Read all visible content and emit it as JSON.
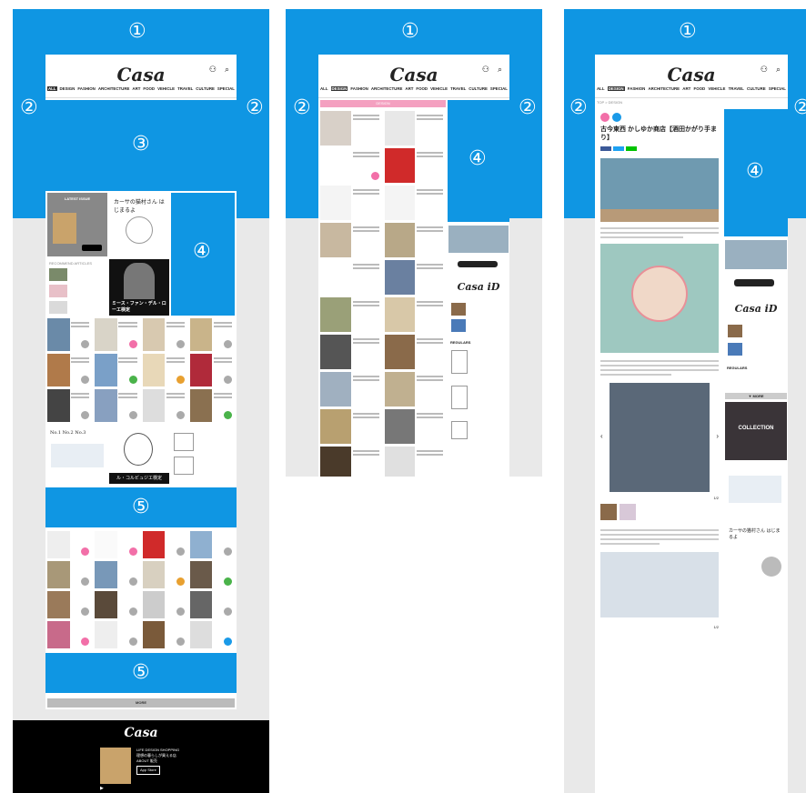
{
  "brand": {
    "logo": "Casa",
    "logo_id": "Casa iD",
    "accent": "#0f96e3"
  },
  "zones": {
    "one": "①",
    "two": "②",
    "three": "③",
    "four": "④",
    "five": "⑤"
  },
  "header": {
    "login_label": "LOGIN",
    "search_label": "SEARCH"
  },
  "nav": {
    "items": [
      "ALL",
      "DESIGN",
      "FASHION",
      "ARCHITECTURE",
      "ART",
      "FOOD",
      "VEHICLE",
      "TRAVEL",
      "CULTURE",
      "SPECIAL"
    ]
  },
  "frame1": {
    "latest_issue": "LATEST ISSUE",
    "recommend": "RECOMMEND ARTICLES",
    "promo_cursive": "カーサの猫村さん はじまるよ",
    "promo_portrait": "ミース・ファン・デル・ローエ検定",
    "promo_corbu": "ル・コルビュジエ検定",
    "more": "MORE",
    "footer_line1": "LIFE DESIGN SHOPPING",
    "footer_line2": "理想の暮らしが買える店",
    "footer_line3": "ABOUT 販売",
    "app_store": "App Store",
    "footer_bottom": "Casa BRUTUS"
  },
  "frame2": {
    "pink_tab": "DESIGN",
    "regulars": "REGULARS"
  },
  "frame3": {
    "breadcrumb": "TOP > DESIGN",
    "article_title": "古今東西 かしゆか商店【酒田かがり手まり】",
    "regulars": "REGULARS",
    "more": "MORE",
    "collection": "COLLECTION",
    "page_indicator_1": "1/2",
    "page_indicator_2": "1/2"
  }
}
